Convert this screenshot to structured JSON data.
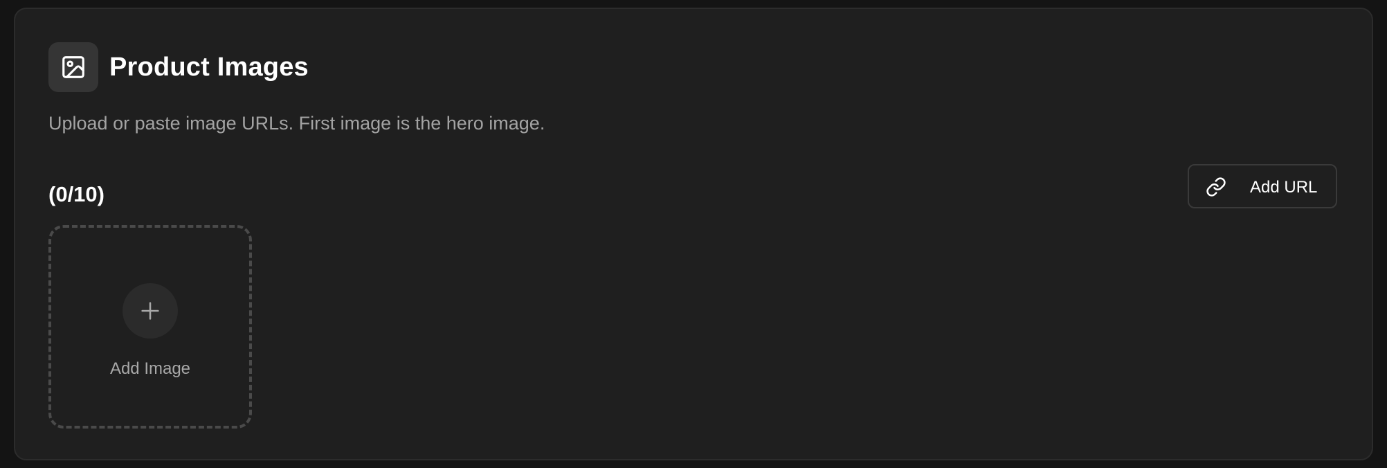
{
  "section": {
    "title": "Product Images",
    "title_icon": "image-icon",
    "subtitle": "Upload or paste image URLs. First image is the hero image."
  },
  "images": {
    "count_label": "(0/10)",
    "current": 0,
    "max": 10
  },
  "add_url_button": {
    "label": "Add URL",
    "icon": "link-icon"
  },
  "dropzone": {
    "label": "Add Image",
    "icon": "plus-icon"
  }
}
